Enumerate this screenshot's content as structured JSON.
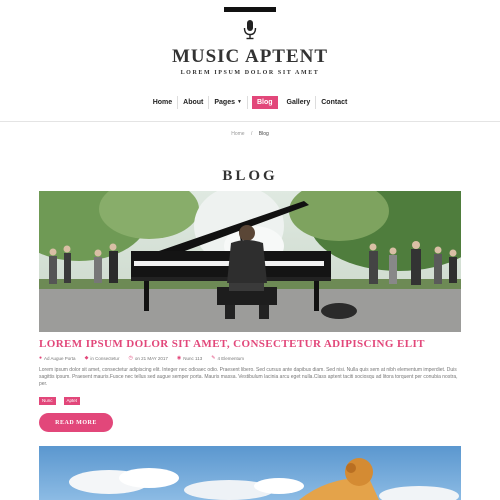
{
  "header": {
    "title": "MUSIC APTENT",
    "tagline": "LOREM IPSUM DOLOR SIT AMET",
    "logo_icon": "microphone-icon"
  },
  "nav": {
    "items": [
      {
        "label": "Home"
      },
      {
        "label": "About"
      },
      {
        "label": "Pages",
        "has_dropdown": true
      },
      {
        "label": "Blog",
        "active": true
      },
      {
        "label": "Gallery"
      },
      {
        "label": "Contact"
      }
    ]
  },
  "breadcrumb": {
    "home": "Home",
    "separator": "/",
    "current": "Blog"
  },
  "page": {
    "section_title": "BLOG"
  },
  "post": {
    "title": "LOREM IPSUM DOLOR SIT AMET, CONSECTETUR ADIPISCING ELIT",
    "meta": {
      "author": "Ad Augue Porta",
      "category": "in Consectetur",
      "date": "on 21 MAY 2017",
      "views": "Nunc 113",
      "comments": "4 Elementum"
    },
    "excerpt": "Lorem ipsum dolor sit amet, consectetur adipiscing elit. Integer nec odioaec odio. Praesent libero. Sed cursus ante dapibus diam. Sed nisi. Nulla quis sem at nibh elementum imperdiet. Duis sagittis ipsum. Praesent mauris.Fusce nec tellus sed augue semper porta. Mauris massa. Vestibulum lacinia arcu eget nulla.Class aptent taciti sociosqu ad litora torquent per conubia nostra, per.",
    "tags": [
      "Nunc",
      "Aptet"
    ],
    "read_more": "READ MORE"
  },
  "colors": {
    "accent": "#e2477a",
    "text": "#333333",
    "muted": "#777777"
  }
}
